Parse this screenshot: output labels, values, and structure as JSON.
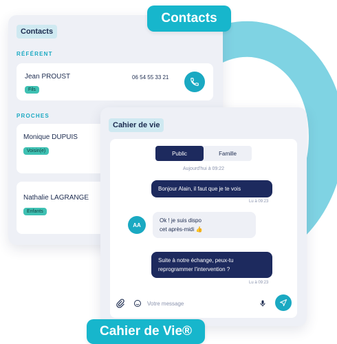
{
  "pills": {
    "contacts": "Contacts",
    "cahier": "Cahier de Vie®"
  },
  "contacts": {
    "title": "Contacts",
    "referent_label": "RÉFÉRENT",
    "proches_label": "PROCHES",
    "referent": {
      "name": "Jean PROUST",
      "badge": "Fils",
      "phone": "06 54 55 33 21"
    },
    "proches": [
      {
        "name": "Monique DUPUIS",
        "badge": "Voisin(e)"
      },
      {
        "name": "Nathalie LAGRANGE",
        "badge": "Enfants"
      }
    ]
  },
  "chat": {
    "title": "Cahier de vie",
    "tabs": [
      "Public",
      "Famille"
    ],
    "date_sep": "Aujourd'hui à 09:22",
    "messages": [
      {
        "text": "Bonjour Alain, il faut que je te vois",
        "time": "Lu à 09:23"
      },
      {
        "line1": "Ok ! je suis dispo",
        "line2": "cet après-midi 👍",
        "avatar": "AA"
      },
      {
        "line1": "Suite à notre échange, peux-tu",
        "line2": "reprogrammer l'intervention ?",
        "time": "Lu à 09:23"
      }
    ],
    "composer_placeholder": "Votre message"
  },
  "colors": {
    "teal": "#1aa9c2",
    "navy": "#1d2a5e",
    "badge_green": "#3fc1b3",
    "arc": "#7fd3e3"
  }
}
